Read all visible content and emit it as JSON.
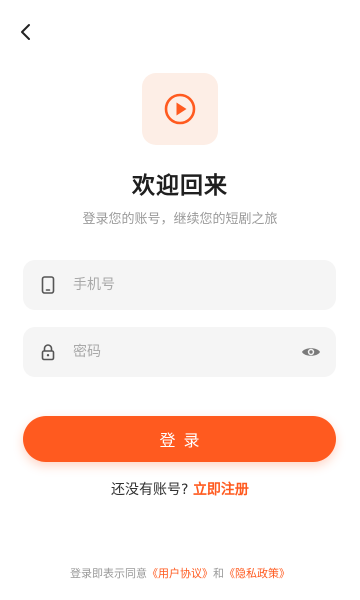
{
  "header": {
    "back_icon": "chevron-left-icon"
  },
  "logo": {
    "icon": "play-circle-icon",
    "accent_color": "#ff5a1f",
    "background_color": "#fdeee6"
  },
  "title": "欢迎回来",
  "subtitle": "登录您的账号，继续您的短剧之旅",
  "form": {
    "phone": {
      "icon": "smartphone-icon",
      "value": "",
      "placeholder": "手机号"
    },
    "password": {
      "icon": "lock-icon",
      "value": "",
      "placeholder": "密码",
      "toggle_icon": "eye-icon"
    },
    "submit_label": "登录"
  },
  "register": {
    "prompt": "还没有账号? ",
    "link_label": "立即注册"
  },
  "agreement": {
    "prefix": "登录即表示同意",
    "terms_label": "《用户协议》",
    "connector": "和",
    "privacy_label": "《隐私政策》"
  },
  "colors": {
    "accent": "#ff5a1f",
    "field_background": "#f5f5f5",
    "muted_text": "#9a9a9a"
  }
}
